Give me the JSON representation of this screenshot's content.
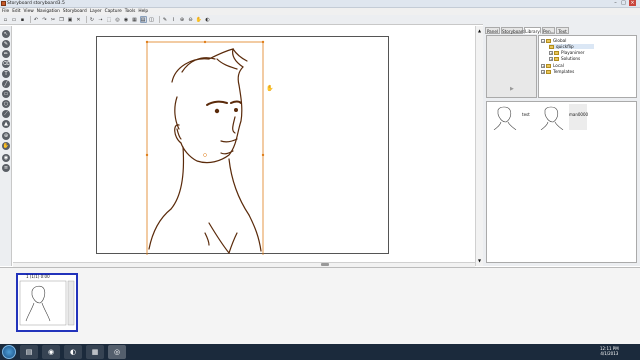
{
  "window": {
    "title": "Storyboard storyboard3.5"
  },
  "menubar": {
    "items": [
      "File",
      "Edit",
      "View",
      "Navigation",
      "Storyboard",
      "Layer",
      "Capture",
      "Tools",
      "Help"
    ]
  },
  "toolbar": {
    "icons": [
      "new-icon",
      "open-icon",
      "save-icon",
      "undo-icon",
      "redo-icon",
      "cut-icon",
      "copy-icon",
      "paste-icon",
      "delete-icon",
      "rotate-icon",
      "arrow-icon",
      "select-icon",
      "scene-icon",
      "panel-icon",
      "layer-icon",
      "camera-icon",
      "onion-icon",
      "pencil-icon",
      "brush-icon",
      "zoom-in-icon",
      "zoom-out-icon",
      "hand-icon",
      "eye-icon"
    ]
  },
  "right_panel": {
    "tabs": [
      "Panel",
      "Storyboard",
      "Library",
      "Pen...",
      "Text"
    ],
    "tree": [
      {
        "label": "Global",
        "level": 0
      },
      {
        "label": "quickflip",
        "level": 1
      },
      {
        "label": "Playanimer",
        "level": 1
      },
      {
        "label": "Solutions",
        "level": 1
      },
      {
        "label": "Local",
        "level": 0
      },
      {
        "label": "Templates",
        "level": 0
      }
    ],
    "library_items": [
      {
        "label": "test"
      },
      {
        "label": "man0000"
      }
    ]
  },
  "bottom_strip": {
    "panel_label": "1 (1/1) 0:00"
  },
  "taskbar": {
    "time": "12:11 PM",
    "date": "4/1/2013"
  },
  "colors": {
    "sketch": "#5a2a0a",
    "selection": "#e07e1a",
    "thumb_border": "#2233bb"
  }
}
